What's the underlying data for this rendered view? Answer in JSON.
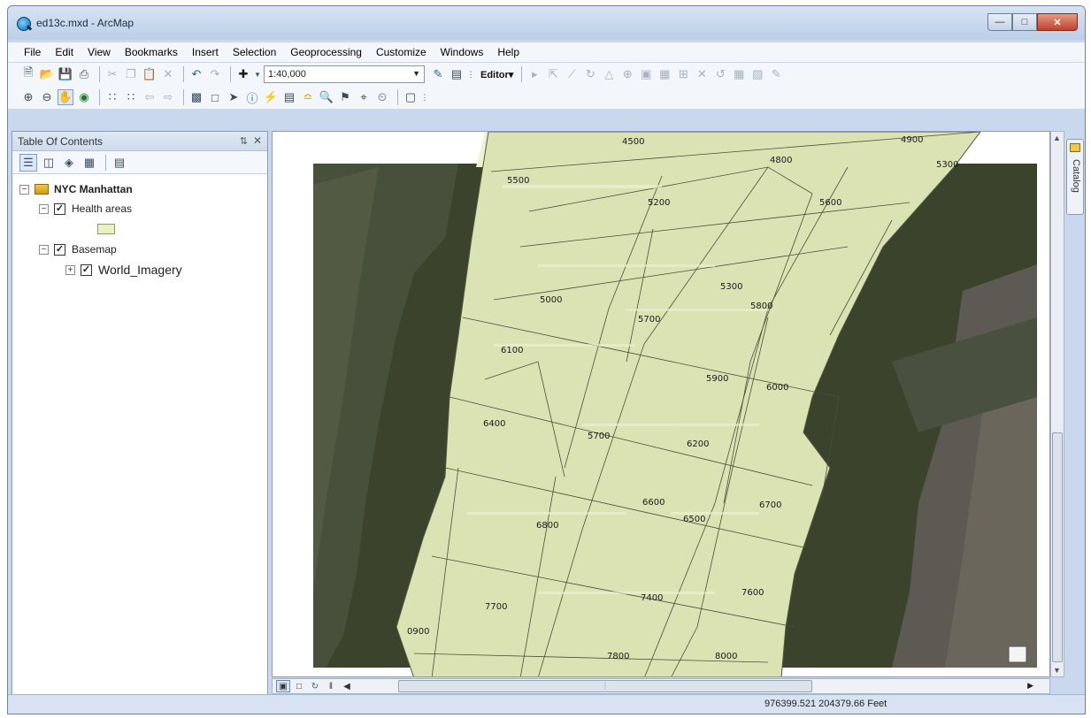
{
  "window": {
    "title": "ed13c.mxd - ArcMap"
  },
  "menu": [
    "File",
    "Edit",
    "View",
    "Bookmarks",
    "Insert",
    "Selection",
    "Geoprocessing",
    "Customize",
    "Windows",
    "Help"
  ],
  "toolbar": {
    "scale": "1:40,000",
    "editor_label": "Editor"
  },
  "toc": {
    "title": "Table Of Contents",
    "dataframe": "NYC Manhattan",
    "layers": [
      {
        "label": "Health areas",
        "checked": true
      },
      {
        "label": "Basemap",
        "checked": true
      },
      {
        "label": "World_Imagery",
        "checked": true
      }
    ]
  },
  "catalog": {
    "label": "Catalog"
  },
  "map": {
    "labels": [
      "4500",
      "4800",
      "4900",
      "5300",
      "5500",
      "5200",
      "5600",
      "5000",
      "5300",
      "5800",
      "5700",
      "6100",
      "5900",
      "6000",
      "6400",
      "5700",
      "6200",
      "6600",
      "6500",
      "6700",
      "6800",
      "7700",
      "7400",
      "7600",
      "0900",
      "7800",
      "8000"
    ]
  },
  "status": {
    "coords": "976399.521  204379.66 Feet"
  },
  "colors": {
    "health_area_fill": "#e8f0c4",
    "water": "#3f4730",
    "title_bar": "#c9d8ec"
  }
}
